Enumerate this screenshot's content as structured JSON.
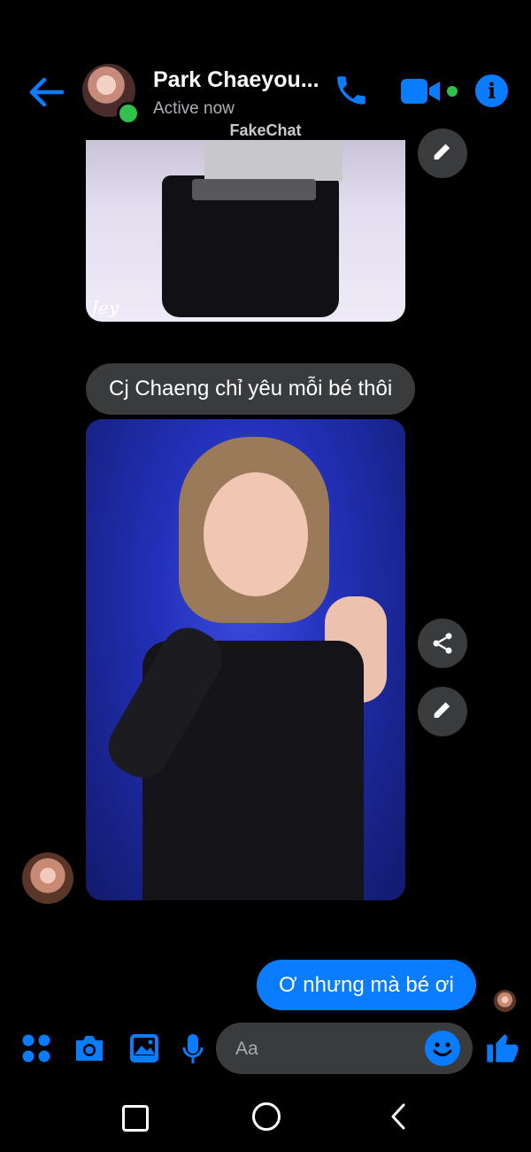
{
  "header": {
    "contact_name": "Park Chaeyou...",
    "status": "Active now",
    "watermark": "FakeChat",
    "icons": [
      "back-arrow-icon",
      "phone-icon",
      "video-camera-icon",
      "info-icon"
    ],
    "accent_color": "#0a7cff",
    "online_color": "#31c24d"
  },
  "messages": [
    {
      "type": "image",
      "sender": "contact",
      "caption_mark": "Jey"
    },
    {
      "type": "text",
      "sender": "contact",
      "text": "Cj Chaeng chỉ yêu mỗi bé thôi"
    },
    {
      "type": "image",
      "sender": "contact"
    },
    {
      "type": "text",
      "sender": "me",
      "text": "Ơ nhưng mà bé ơi"
    }
  ],
  "message_actions": [
    "edit-icon",
    "share-icon",
    "edit-icon"
  ],
  "composer": {
    "placeholder": "Aa",
    "icons": [
      "apps-grid-icon",
      "camera-icon",
      "gallery-icon",
      "microphone-icon",
      "emoji-icon",
      "thumbs-up-icon"
    ]
  },
  "system_nav": [
    "recent-apps-icon",
    "home-icon",
    "back-icon"
  ]
}
